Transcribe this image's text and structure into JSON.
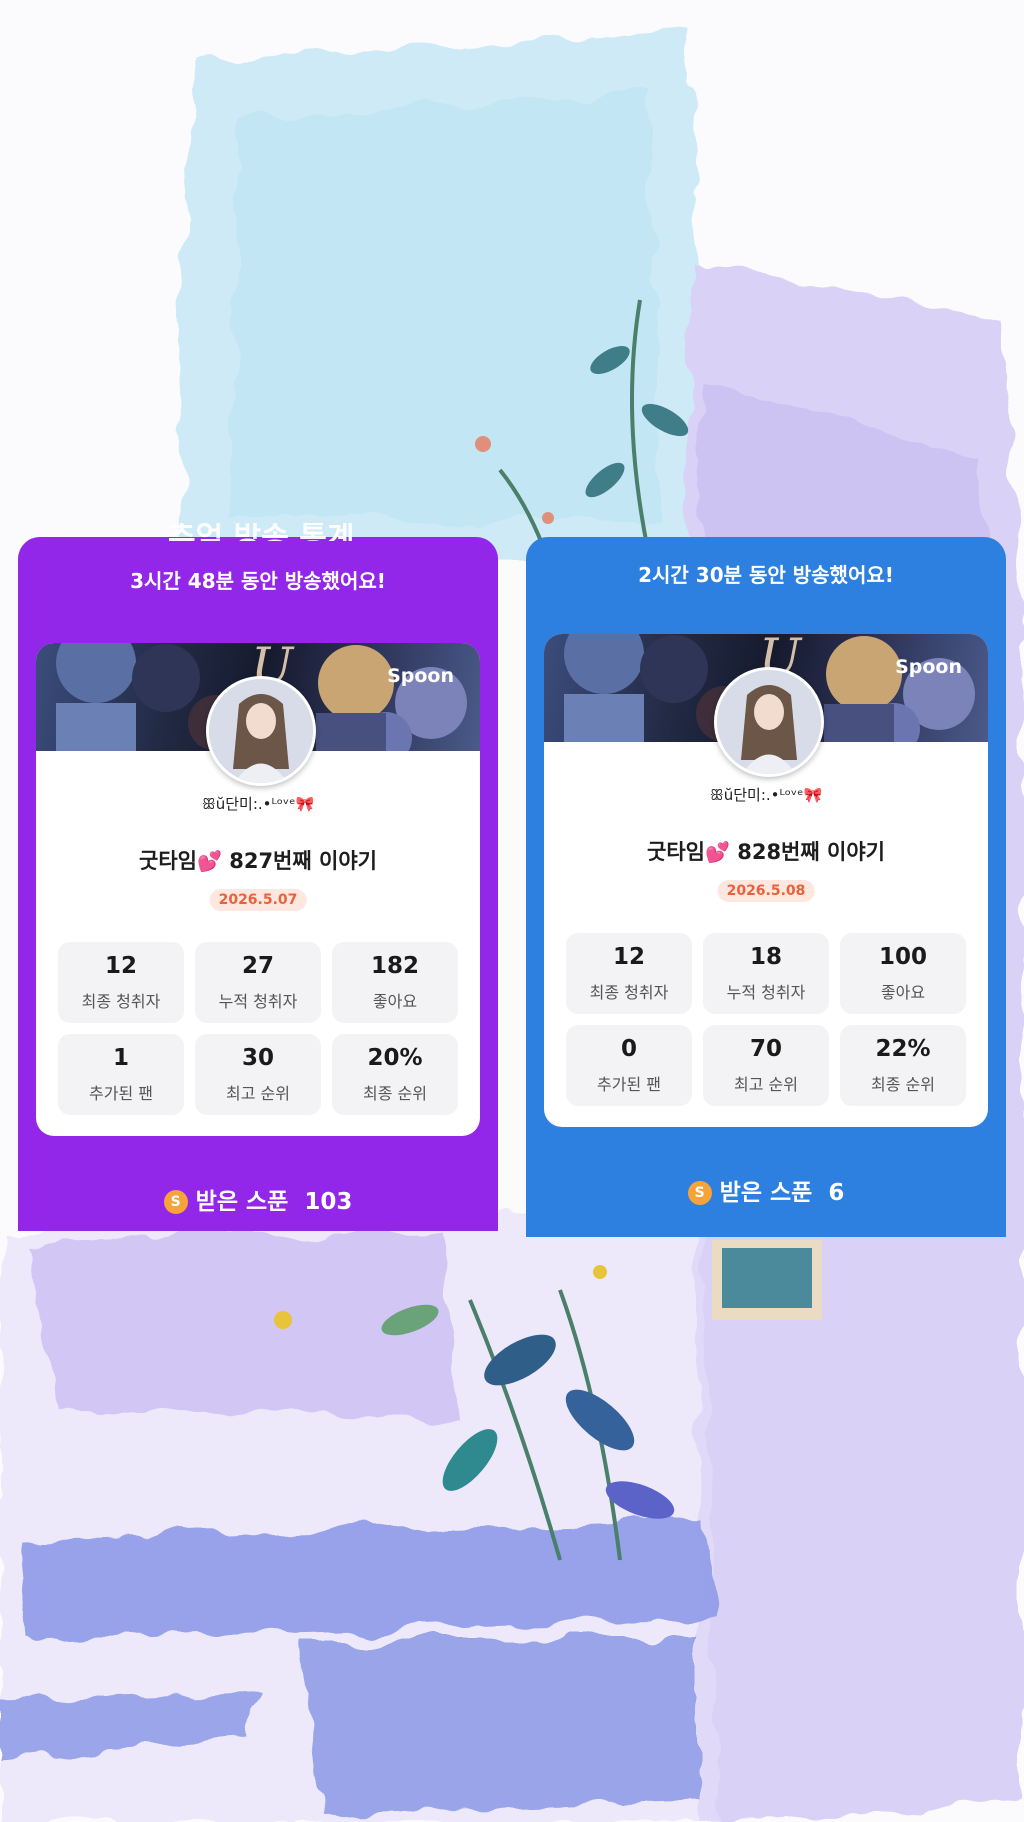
{
  "cards": [
    {
      "cut_title": "추억 방송 통계",
      "header": "3시간 48분 동안 방송했어요!",
      "brand": "Spoon",
      "nickname": "ꕥŭ단미:.•ᴸᵒᵛᵉ🎀",
      "title_text": "굿타임",
      "title_heart": "💕",
      "title_rest": " 827번째 이야기",
      "date": "2026.5.07",
      "stats": [
        {
          "value": "12",
          "label": "최종 청취자"
        },
        {
          "value": "27",
          "label": "누적 청취자"
        },
        {
          "value": "182",
          "label": "좋아요"
        },
        {
          "value": "1",
          "label": "추가된 팬"
        },
        {
          "value": "30",
          "label": "최고 순위"
        },
        {
          "value": "20%",
          "label": "최종 순위"
        }
      ],
      "coin_symbol": "S",
      "spoon_label": "받은 스푼",
      "spoon_count": "103",
      "color": "#9226e9"
    },
    {
      "header": "2시간 30분 동안 방송했어요!",
      "brand": "Spoon",
      "nickname": "ꕥŭ단미:.•ᴸᵒᵛᵉ🎀",
      "title_text": "굿타임",
      "title_heart": "💕",
      "title_rest": " 828번째 이야기",
      "date": "2026.5.08",
      "stats": [
        {
          "value": "12",
          "label": "최종 청취자"
        },
        {
          "value": "18",
          "label": "누적 청취자"
        },
        {
          "value": "100",
          "label": "좋아요"
        },
        {
          "value": "0",
          "label": "추가된 팬"
        },
        {
          "value": "70",
          "label": "최고 순위"
        },
        {
          "value": "22%",
          "label": "최종 순위"
        }
      ],
      "coin_symbol": "S",
      "spoon_label": "받은 스푼",
      "spoon_count": "6",
      "color": "#2d7fe0"
    }
  ],
  "icons": {
    "coin": "spoon-coin-icon",
    "banner": "anime-group-banner-image",
    "avatar": "profile-avatar-image"
  }
}
